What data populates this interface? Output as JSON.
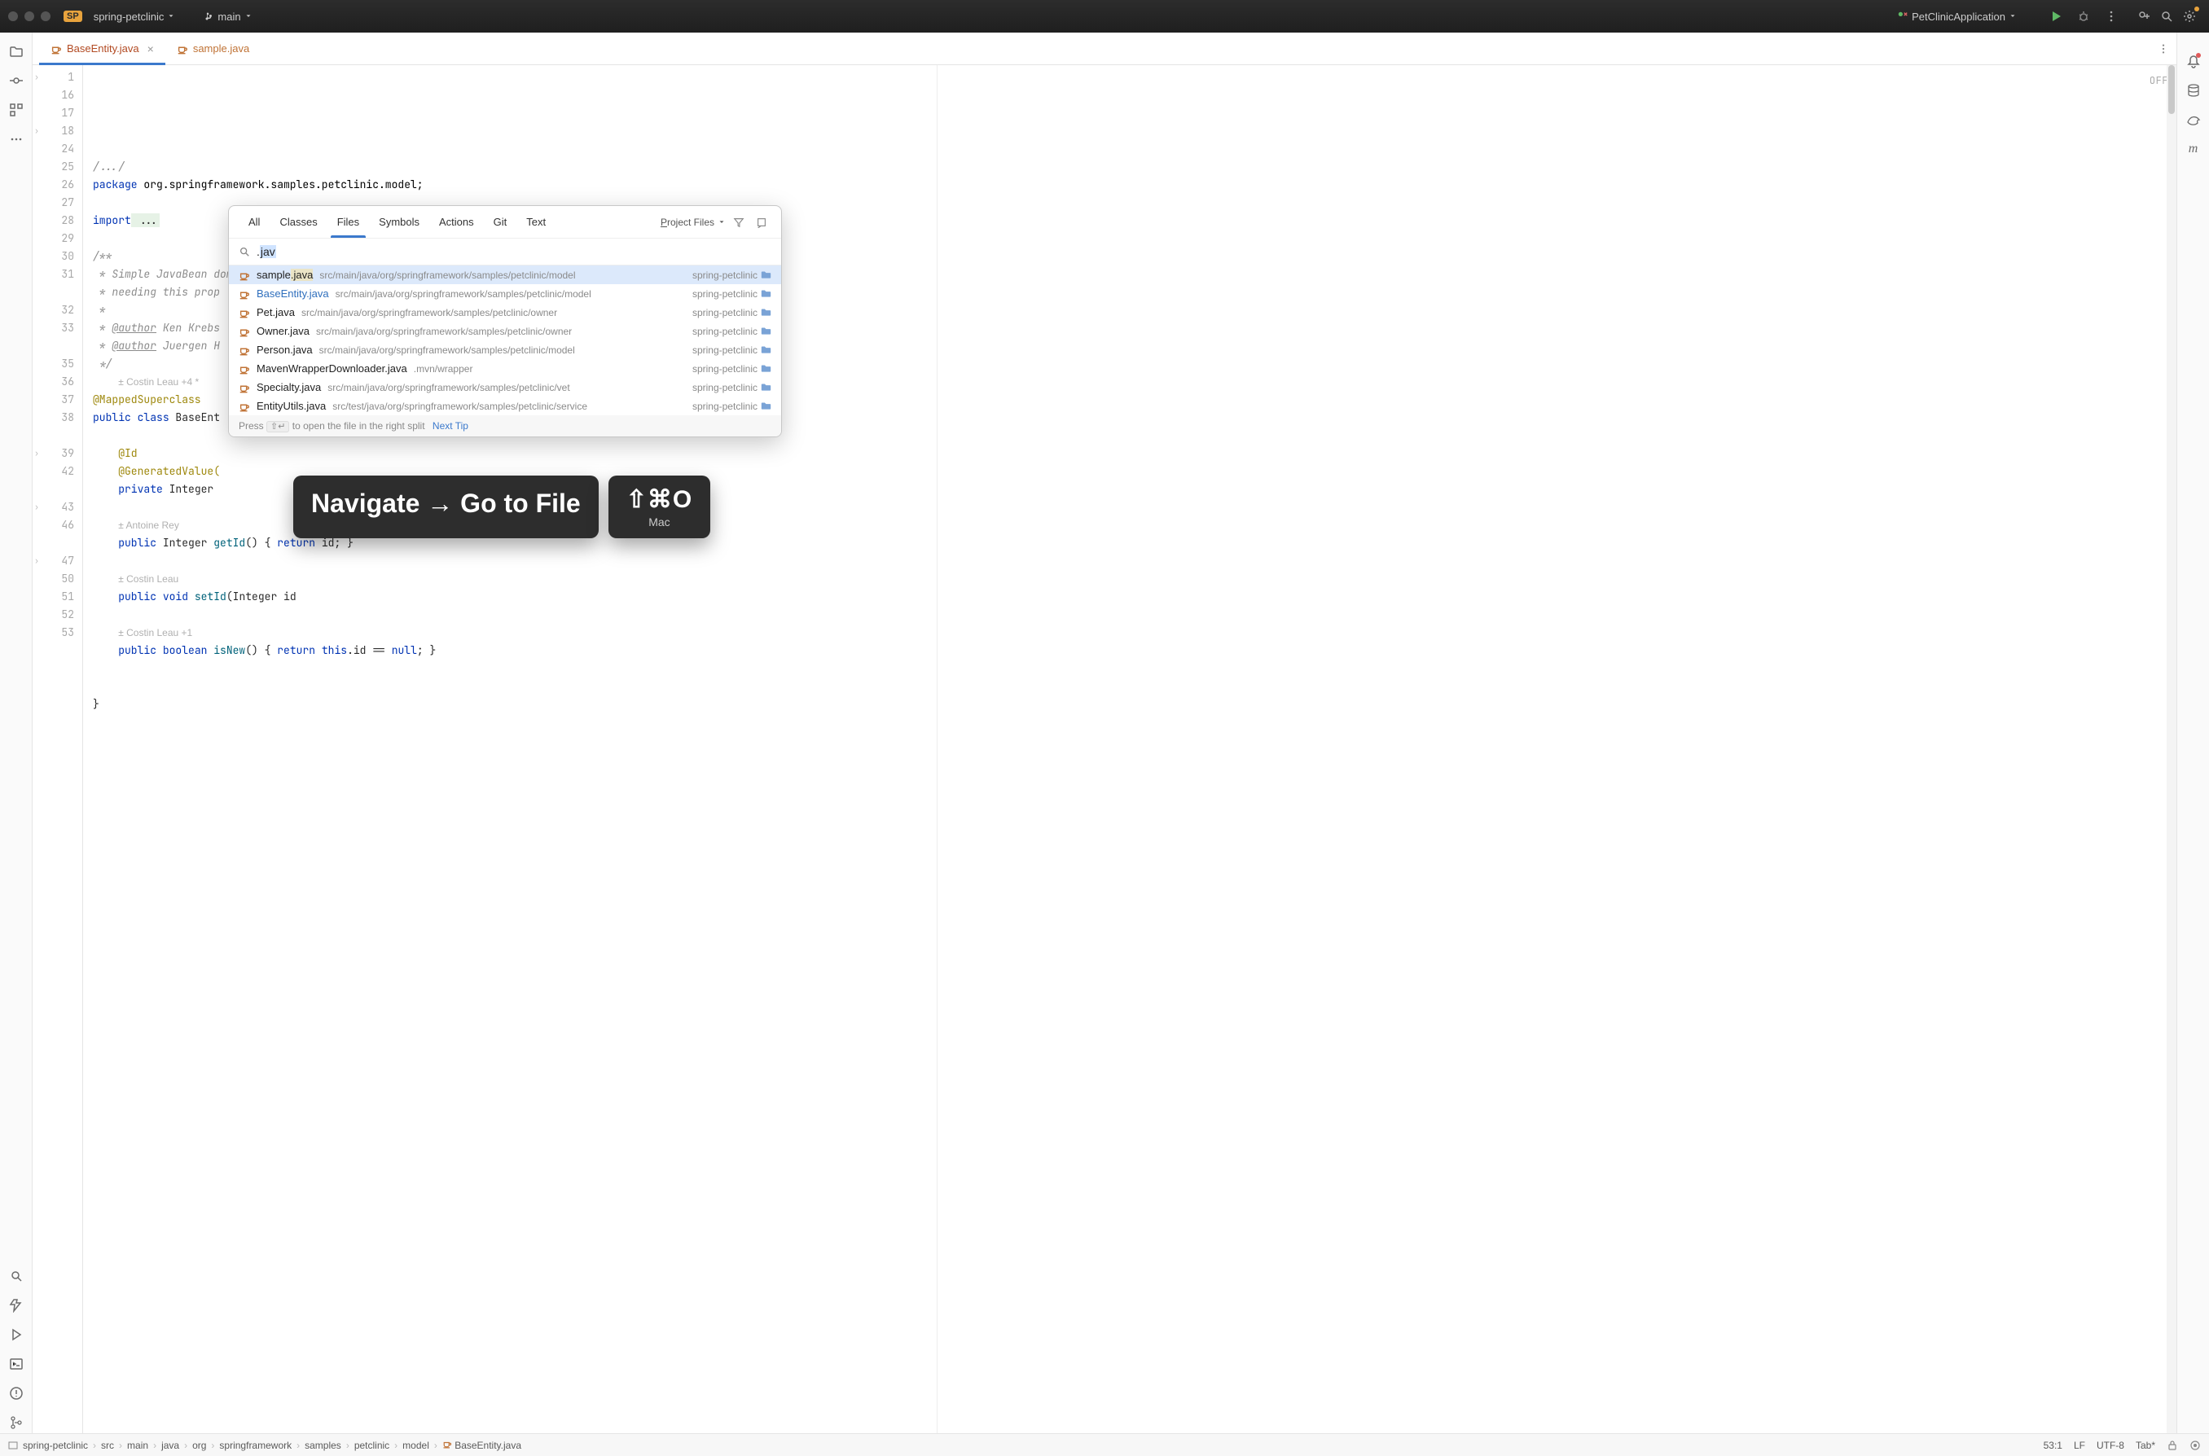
{
  "titlebar": {
    "projectBadge": "SP",
    "projectName": "spring-petclinic",
    "branchLabel": "main",
    "runConfig": "PetClinicApplication"
  },
  "tabs": [
    {
      "label": "BaseEntity.java",
      "active": true,
      "closeVisible": true
    },
    {
      "label": "sample.java",
      "active": false,
      "closeVisible": false
    }
  ],
  "hintsBadge": "OFF",
  "gutterLines": [
    "1",
    "16",
    "17",
    "18",
    "24",
    "25",
    "26",
    "27",
    "28",
    "29",
    "30",
    "31",
    "",
    "32",
    "33",
    "",
    "35",
    "36",
    "37",
    "38",
    "",
    "39",
    "42",
    "",
    "43",
    "46",
    "",
    "47",
    "50",
    "51",
    "52",
    "53"
  ],
  "folds": {
    "0": true,
    "3": true,
    "21": true,
    "24": true,
    "27": true
  },
  "marks": {
    "17": true,
    "30": true
  },
  "code": {
    "l0": "/.../",
    "l1_kw": "package",
    "l1_rest": " org.springframework.samples.petclinic.model;",
    "l2": "",
    "l3_kw": "import",
    "l3_hl": " ...",
    "l4_sp": "",
    "l5": "/**",
    "l6": " * Simple JavaBean domain object with an id property. Used as a base class for objects",
    "l7": " * needing this prop",
    "l8": " *",
    "l9": " * @author Ken Krebs",
    "l10": " * @author Juergen H",
    "l11": " */",
    "ia1": "Costin Leau +4 *",
    "l12": "@MappedSuperclass",
    "l13_a": "public",
    "l13_b": " class",
    "l13_c": " BaseEnt",
    "ia2_sp": "",
    "l14": "    @Id",
    "l15": "    @GeneratedValue(",
    "l16_a": "    private",
    "l16_b": " Integer ",
    "ia3": "Antoine Rey",
    "l17_a": "    public",
    "l17_b": " Integer ",
    "l17_c": "getId",
    "l17_d": "() { ",
    "l17_e": "return",
    "l17_f": " id; }",
    "ia4": "Costin Leau",
    "l18_a": "    public",
    "l18_b": " void",
    "l18_c": " setId",
    "l18_d": "(Integer id",
    "ia5": "Costin Leau +1",
    "l19_a": "    public",
    "l19_b": " boolean",
    "l19_c": " isNew",
    "l19_d": "() { ",
    "l19_e": "return",
    "l19_f": " this",
    "l19_g": ".id == ",
    "l19_h": "null",
    "l19_i": "; }",
    "l20": "",
    "l21": "}",
    "l22": ""
  },
  "popup": {
    "tabs": [
      "All",
      "Classes",
      "Files",
      "Symbols",
      "Actions",
      "Git",
      "Text"
    ],
    "activeTab": "Files",
    "scopeLabel": "Project Files",
    "query": ".jav",
    "queryPrefix": ".",
    "querySel": "jav",
    "results": [
      {
        "name": "sample.java",
        "nameHl": "sample",
        "ext": ".java",
        "path": "src/main/java/org/springframework/samples/petclinic/model",
        "module": "spring-petclinic",
        "blue": false,
        "selected": true
      },
      {
        "name": "BaseEntity.java",
        "path": "src/main/java/org/springframework/samples/petclinic/model",
        "module": "spring-petclinic",
        "blue": true
      },
      {
        "name": "Pet.java",
        "path": "src/main/java/org/springframework/samples/petclinic/owner",
        "module": "spring-petclinic"
      },
      {
        "name": "Owner.java",
        "path": "src/main/java/org/springframework/samples/petclinic/owner",
        "module": "spring-petclinic"
      },
      {
        "name": "Person.java",
        "path": "src/main/java/org/springframework/samples/petclinic/model",
        "module": "spring-petclinic"
      },
      {
        "name": "MavenWrapperDownloader.java",
        "path": ".mvn/wrapper",
        "module": "spring-petclinic"
      },
      {
        "name": "Specialty.java",
        "path": "src/main/java/org/springframework/samples/petclinic/vet",
        "module": "spring-petclinic"
      },
      {
        "name": "EntityUtils.java",
        "path": "src/test/java/org/springframework/samples/petclinic/service",
        "module": "spring-petclinic"
      }
    ],
    "hintPrefix": "Press ",
    "hintKey": "⇧↵",
    "hintSuffix": " to open the file in the right split",
    "nextTip": "Next Tip"
  },
  "cards": {
    "action": "Navigate → Go to File",
    "shortcut": "⇧⌘O",
    "platform": "Mac"
  },
  "breadcrumbs": [
    "spring-petclinic",
    "src",
    "main",
    "java",
    "org",
    "springframework",
    "samples",
    "petclinic",
    "model",
    "BaseEntity.java"
  ],
  "status": {
    "pos": "53:1",
    "lf": "LF",
    "enc": "UTF-8",
    "indent": "Tab*"
  }
}
